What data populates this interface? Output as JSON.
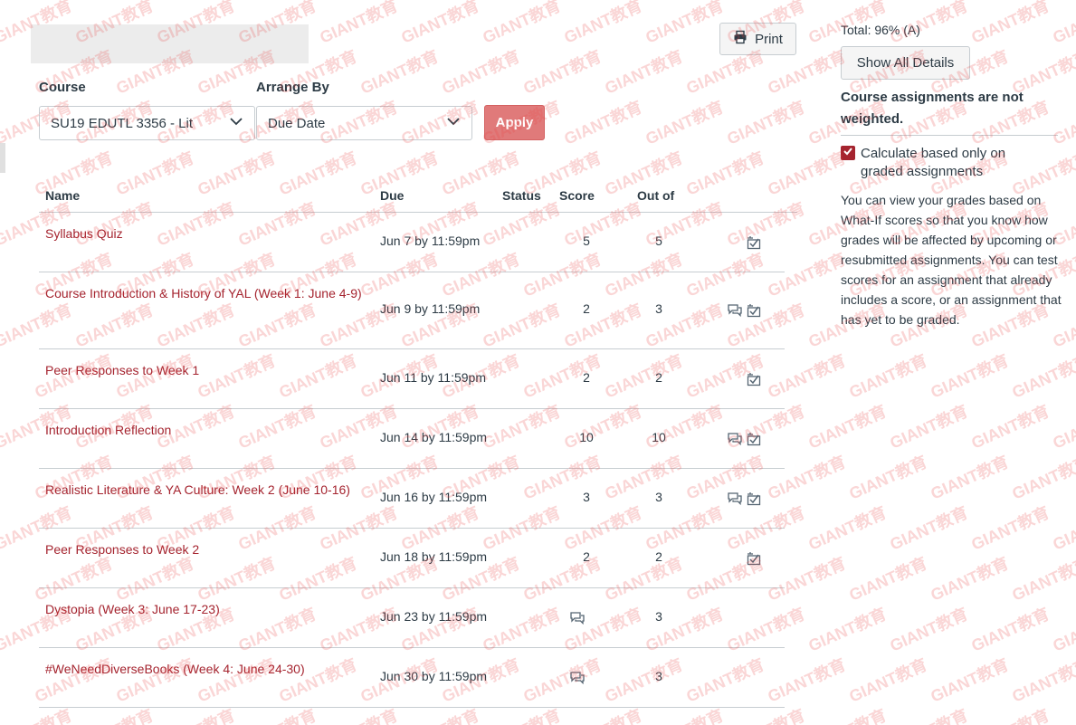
{
  "toolbar": {
    "print_label": "Print"
  },
  "filters": {
    "course_label": "Course",
    "course_value": "SU19 EDUTL 3356 - Lit",
    "arrange_label": "Arrange By",
    "arrange_value": "Due Date",
    "apply_label": "Apply"
  },
  "table": {
    "columns": [
      "Name",
      "Due",
      "Status",
      "Score",
      "Out of"
    ],
    "rows": [
      {
        "name": "Syllabus Quiz",
        "due": "Jun 7 by 11:59pm",
        "score": "5",
        "out_of": "5",
        "comment_icon": false,
        "rubric_icon": true
      },
      {
        "name": "Course Introduction & History of YAL (Week 1: June 4-9)",
        "due": "Jun 9 by 11:59pm",
        "score": "2",
        "out_of": "3",
        "comment_icon": true,
        "rubric_icon": true
      },
      {
        "name": "Peer Responses to Week 1",
        "due": "Jun 11 by 11:59pm",
        "score": "2",
        "out_of": "2",
        "comment_icon": false,
        "rubric_icon": true
      },
      {
        "name": "Introduction Reflection",
        "due": "Jun 14 by 11:59pm",
        "score": "10",
        "out_of": "10",
        "comment_icon": true,
        "rubric_icon": true
      },
      {
        "name": "Realistic Literature & YA Culture: Week 2 (June 10-16)",
        "due": "Jun 16 by 11:59pm",
        "score": "3",
        "out_of": "3",
        "comment_icon": true,
        "rubric_icon": true
      },
      {
        "name": "Peer Responses to Week 2",
        "due": "Jun 18 by 11:59pm",
        "score": "2",
        "out_of": "2",
        "comment_icon": false,
        "rubric_icon": true
      },
      {
        "name": "Dystopia (Week 3: June 17-23)",
        "due": "Jun 23 by 11:59pm",
        "score": "",
        "out_of": "3",
        "comment_icon": true,
        "rubric_icon": false
      },
      {
        "name": "#WeNeedDiverseBooks (Week 4: June 24-30)",
        "due": "Jun 30 by 11:59pm",
        "score": "",
        "out_of": "3",
        "comment_icon": true,
        "rubric_icon": false
      }
    ]
  },
  "sidebar": {
    "total": "Total: 96% (A)",
    "details_button": "Show All Details",
    "weight_note": "Course assignments are not weighted.",
    "checkbox_label": "Calculate based only on graded assignments",
    "checkbox_checked": true,
    "whatif_text": "You can view your grades based on What-If scores so that you know how grades will be affected by upcoming or resubmitted assignments. You can test scores for an assignment that already includes a score, or an assignment that has yet to be graded."
  },
  "watermark": {
    "text": "GIANT教育"
  },
  "colors": {
    "link": "#a5242f",
    "apply_button": "#e07a7a",
    "text": "#2d3b45",
    "border": "#c7cdd1"
  }
}
